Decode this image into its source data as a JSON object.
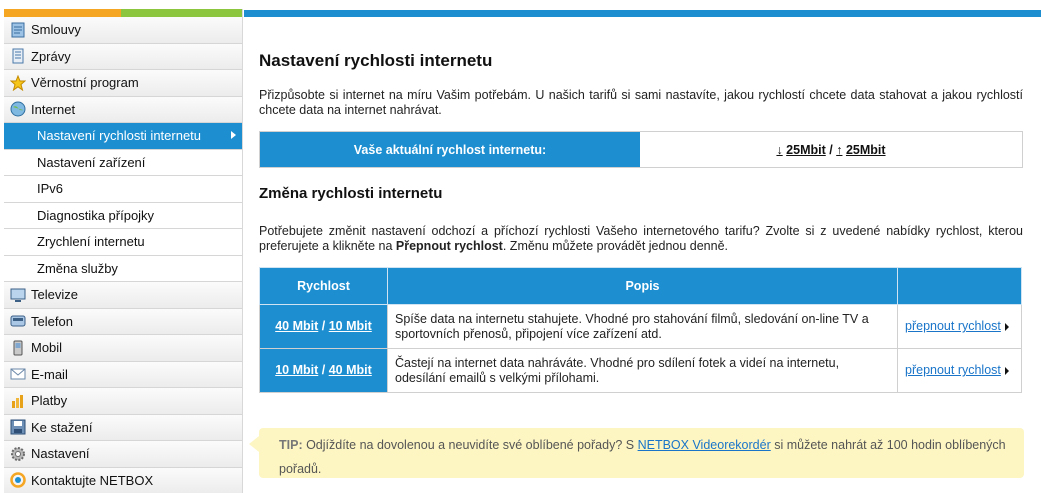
{
  "sidebar": {
    "items": [
      {
        "label": "Smlouvy",
        "icon": "contract-icon"
      },
      {
        "label": "Zprávy",
        "icon": "messages-icon"
      },
      {
        "label": "Věrnostní program",
        "icon": "star-icon"
      },
      {
        "label": "Internet",
        "icon": "globe-icon"
      },
      {
        "label": "Nastavení rychlosti internetu",
        "sub": true,
        "active": true
      },
      {
        "label": "Nastavení zařízení",
        "sub": true
      },
      {
        "label": "IPv6",
        "sub": true
      },
      {
        "label": "Diagnostika přípojky",
        "sub": true
      },
      {
        "label": "Zrychlení internetu",
        "sub": true
      },
      {
        "label": "Změna služby",
        "sub": true
      },
      {
        "label": "Televize",
        "icon": "tv-icon"
      },
      {
        "label": "Telefon",
        "icon": "phone-icon"
      },
      {
        "label": "Mobil",
        "icon": "mobile-icon"
      },
      {
        "label": "E-mail",
        "icon": "email-icon"
      },
      {
        "label": "Platby",
        "icon": "payments-icon"
      },
      {
        "label": "Ke stažení",
        "icon": "download-icon"
      },
      {
        "label": "Nastavení",
        "icon": "settings-icon"
      },
      {
        "label": "Kontaktujte NETBOX",
        "icon": "contact-icon"
      }
    ]
  },
  "main": {
    "title": "Nastavení rychlosti internetu",
    "intro": "Přizpůsobte si internet na míru Vašim potřebám. U našich tarifů si sami nastavíte, jakou rychlostí chcete data stahovat a jakou rychlostí chcete data na internet nahrávat.",
    "current_speed": {
      "label": "Vaše aktuální rychlost internetu:",
      "down_arrow": "↓",
      "down": "25Mbit",
      "separator": "/",
      "up_arrow": "↑",
      "up": "25Mbit"
    },
    "change_title": "Změna rychlosti internetu",
    "change_text_before": "Potřebujete změnit nastavení odchozí a příchozí rychlosti Vašeho internetového tarifu? Zvolte si z uvedené nabídky rychlost, kterou preferujete a klikněte na ",
    "change_text_bold": "Přepnout rychlost",
    "change_text_after": ". Změnu můžete provádět jednou denně.",
    "table": {
      "headers": [
        "Rychlost",
        "Popis",
        ""
      ],
      "rows": [
        {
          "down": "40 Mbit",
          "sep": "/",
          "up": "10 Mbit",
          "desc": "Spíše data na internetu stahujete. Vhodné pro stahování filmů, sledování on-line TV a sportovních přenosů, připojení více zařízení atd.",
          "action": "přepnout rychlost"
        },
        {
          "down": "10 Mbit",
          "sep": "/",
          "up": "40 Mbit",
          "desc": "Častejí na internet data nahráváte. Vhodné pro sdílení fotek a videí na internetu, odesílání emailů s velkými přílohami.",
          "action": "přepnout rychlost"
        }
      ]
    },
    "tip": {
      "label": "TIP:",
      "text_before": " Odjíždíte na dovolenou a neuvidíte své oblíbené pořady? S ",
      "link": "NETBOX Videorekordér",
      "text_after": " si můžete nahrát až 100 hodin oblíbených pořadů."
    }
  },
  "colors": {
    "accent": "#1d8fd1",
    "orange": "#f5a623",
    "green": "#8cc63f",
    "tip_bg": "#fdf6c3"
  }
}
